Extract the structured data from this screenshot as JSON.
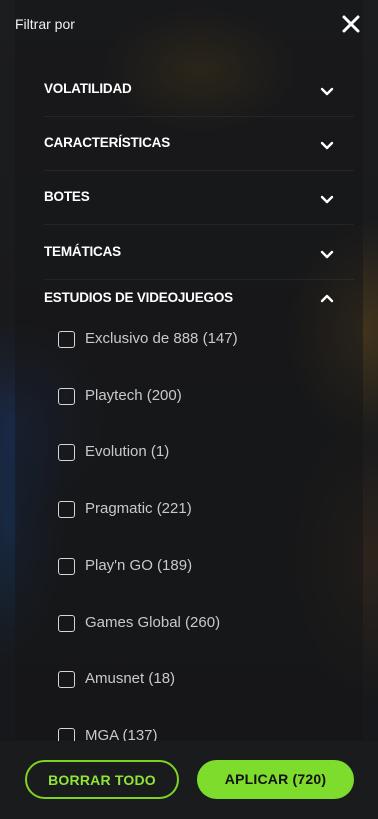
{
  "header": {
    "title": "Filtrar por"
  },
  "sections": [
    {
      "label": "VOLATILIDAD",
      "expanded": false
    },
    {
      "label": "CARACTERÍSTICAS",
      "expanded": false
    },
    {
      "label": "BOTES",
      "expanded": false
    },
    {
      "label": "TEMÁTICAS",
      "expanded": false
    },
    {
      "label": "ESTUDIOS DE VIDEOJUEGOS",
      "expanded": true
    }
  ],
  "studios": [
    {
      "label": "Exclusivo de 888 (147)",
      "checked": false
    },
    {
      "label": "Playtech (200)",
      "checked": false
    },
    {
      "label": "Evolution (1)",
      "checked": false
    },
    {
      "label": "Pragmatic (221)",
      "checked": false
    },
    {
      "label": "Play'n GO (189)",
      "checked": false
    },
    {
      "label": "Games Global (260)",
      "checked": false
    },
    {
      "label": "Amusnet (18)",
      "checked": false
    },
    {
      "label": "MGA (137)",
      "checked": false
    }
  ],
  "footer": {
    "clear_label": "BORRAR TODO",
    "apply_label": "APLICAR (720)"
  },
  "colors": {
    "accent": "#7edc2c",
    "background": "#16181b",
    "text": "#ffffff"
  },
  "icons": {
    "close": "close-icon",
    "collapsed": "chevron-down-icon",
    "expanded": "chevron-up-icon",
    "checkbox": "checkbox-icon"
  }
}
